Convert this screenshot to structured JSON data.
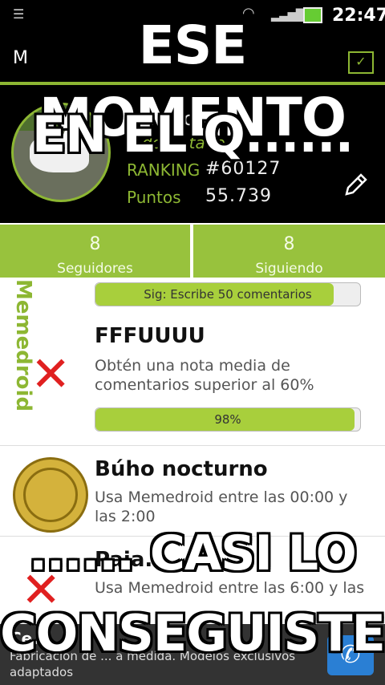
{
  "status_bar": {
    "time": "22:47",
    "icons": [
      "menu-icon",
      "wifi-icon",
      "signal-icon",
      "battery-icon"
    ]
  },
  "app_bar": {
    "title": "M",
    "action_icon": "edit-check-icon"
  },
  "profile": {
    "name": "alberto M...",
    "subtitle": "...dor ...tado",
    "ranking_label": "RANKING",
    "ranking_value": "#60127",
    "points_label": "Puntos",
    "points_value": "55.739"
  },
  "stats": [
    {
      "count": "8",
      "label": "Seguidores"
    },
    {
      "count": "8",
      "label": "Siguiendo"
    }
  ],
  "achievements": [
    {
      "progress_text": "Sig:  Escribe 50 comentarios",
      "progress": 0.9
    },
    {
      "title": "FFFUUUU",
      "description": "Obtén una nota media de comentarios superior al 60%",
      "progress_text": "98%",
      "progress": 0.98
    },
    {
      "title": "Búho nocturno",
      "description": "Usa Memedroid entre las 00:00 y las 2:00"
    },
    {
      "title": "Paja...",
      "description": "Usa Memedroid entre las 6:00 y las"
    }
  ],
  "watermark": "Memedroid",
  "ad": {
    "title": "Ce...",
    "description": "Fabricación de ... a medida. Modelos exclusivos adaptados"
  },
  "meme": {
    "top_line1": "ESE MOMENTO",
    "top_line2": "EN EL Q......",
    "bottom_line1": "...... CASI LO",
    "bottom_line2": "CONSEGUISTE"
  }
}
